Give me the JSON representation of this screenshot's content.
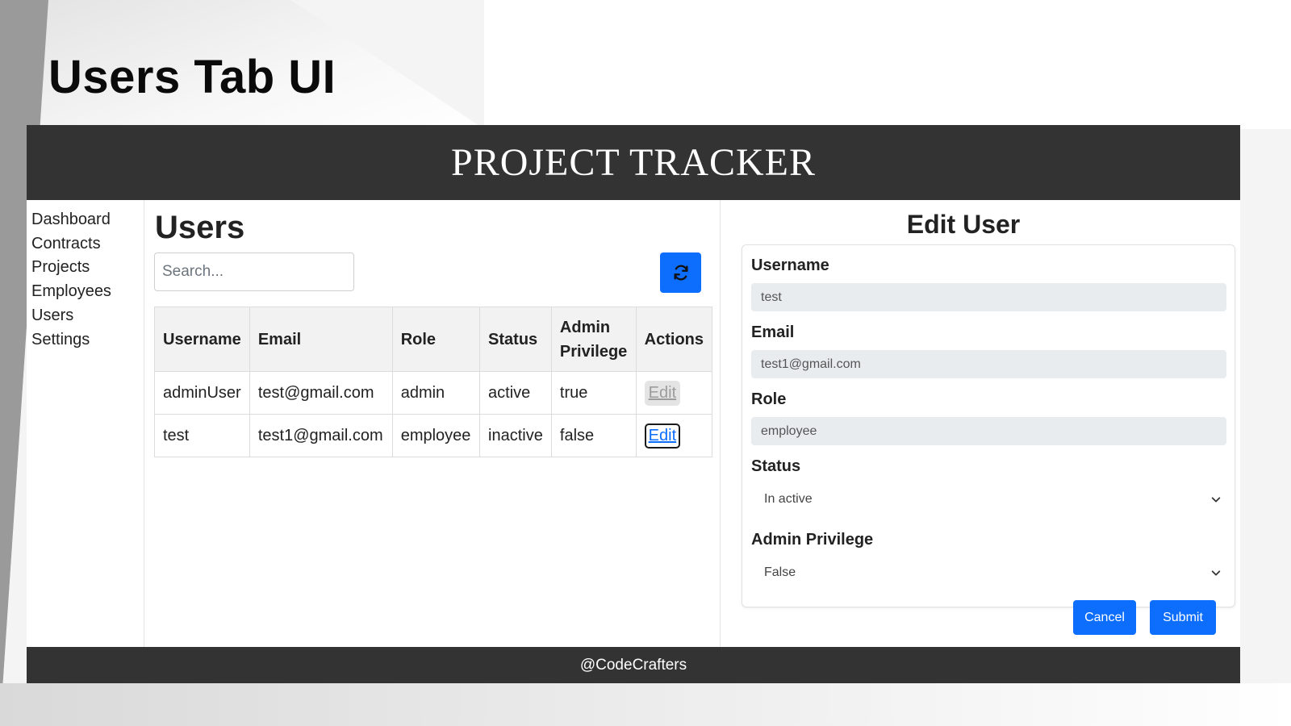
{
  "slide": {
    "title": "Users Tab UI"
  },
  "app": {
    "title": "PROJECT TRACKER",
    "footer": "@CodeCrafters"
  },
  "sidebar": {
    "items": [
      {
        "label": "Dashboard"
      },
      {
        "label": "Contracts"
      },
      {
        "label": "Projects"
      },
      {
        "label": "Employees"
      },
      {
        "label": "Users"
      },
      {
        "label": "Settings"
      }
    ]
  },
  "users": {
    "title": "Users",
    "search": {
      "placeholder": "Search..."
    },
    "refresh_icon": "refresh-icon",
    "table": {
      "headers": {
        "username": "Username",
        "email": "Email",
        "role": "Role",
        "status": "Status",
        "admin_line1": "Admin",
        "admin_line2": "Privilege",
        "actions": "Actions"
      },
      "rows": [
        {
          "username": "adminUser",
          "email": "test@gmail.com",
          "role": "admin",
          "status": "active",
          "admin": "true",
          "action": "Edit"
        },
        {
          "username": "test",
          "email": "test1@gmail.com",
          "role": "employee",
          "status": "inactive",
          "admin": "false",
          "action": "Edit"
        }
      ]
    }
  },
  "edit_user": {
    "title": "Edit User",
    "username": {
      "label": "Username",
      "value": "test"
    },
    "email": {
      "label": "Email",
      "value": "test1@gmail.com"
    },
    "role": {
      "label": "Role",
      "value": "employee"
    },
    "status": {
      "label": "Status",
      "value": "In active"
    },
    "admin_privilege": {
      "label": "Admin Privilege",
      "value": "False"
    },
    "cancel_label": "Cancel",
    "submit_label": "Submit"
  },
  "colors": {
    "header_bg": "#333333",
    "primary": "#0d6efd",
    "readonly_bg": "#e9ecef"
  }
}
